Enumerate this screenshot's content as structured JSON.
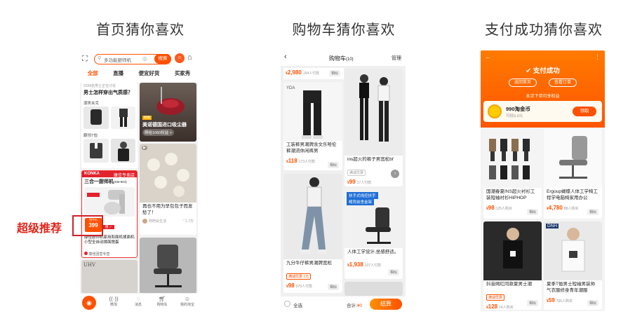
{
  "titles": [
    "首页猜你喜欢",
    "购物车猜你喜欢",
    "支付成功猜你喜欢"
  ],
  "callout": "超级推荐",
  "home": {
    "search_placeholder": "多功能厨师机",
    "search_btn": "搜索",
    "tabs": [
      "全部",
      "直播",
      "便宜好货",
      "买家秀"
    ],
    "c1_top": "9158名男士正在讨论",
    "c1_title": "男士怎样穿出气质感？",
    "c1_sec1": "潮男夹克",
    "c1_sec2": "翻领T恤",
    "c2_badge": "特惠",
    "c2_title": "美诺德国进口吸尘器",
    "c2_sub": "刚给1060权益 >",
    "konka": "KONKA",
    "konka_store": "康佳专卖店",
    "konka_title": "三合一厨师机",
    "konka_model": "(KM-904)",
    "konka_price": "399",
    "konka_free": "到手价",
    "konka_desc": "康佳厨师机家用和面机揉面机小型全自动揉面搅蛋",
    "konka_shop": "康佳团营专营",
    "bun_title": "再也不用为早包包子而发愁了！",
    "bun_user": "阿阿会生活",
    "bun_likes": "1.7万",
    "uhv": "UHV",
    "nav": [
      "微淘",
      "消息",
      "购物车",
      "我的淘宝"
    ]
  },
  "cart": {
    "title": "购物车",
    "count": "(10)",
    "manage": "管理",
    "top_price": "2,980",
    "top_sold": "194人付款",
    "p1_title": "工装裤男潮牌余文乐哈伦裤潮流休闲裤男",
    "p1_price": "118",
    "p1_sold": "173人付款",
    "p2_title": "ins超火的裤子男宽松bf",
    "p2_tag": "满减优惠",
    "p2_price": "99",
    "p2_sold": "17人付款",
    "p3_title": "九分牛仔裤男潮牌宽松",
    "p3_tag": "满减优惠 1元",
    "p3_price": "98",
    "p3_sold": "579人付款",
    "p4_banner": "扶手式线控扶手",
    "p4_banner2": "椅背前舍金架",
    "p4_title": "人体工学设计,坐感舒适。",
    "p4_price": "1,938",
    "p4_sold": "107人付款",
    "similar": "相似",
    "select_all": "全选",
    "total": "合计:",
    "total_val": "¥0",
    "checkout": "结算"
  },
  "pay": {
    "title": "支付成功",
    "back_home": "返回首页",
    "view_order": "查看订单",
    "rights": "本次下单可享权益",
    "coin": "990淘金币",
    "coin_sub": "可抵9.9元",
    "claim": "领取",
    "p1_title": "国潮春夏INS超火衬衫工装短袖衬衫HIPHOP",
    "p1_price": "98",
    "p1_sold": "125人购买",
    "p2_title": "Ergoup蝴蝶人体工学椅工程学电脑椅家用办公",
    "p2_price": "4,780",
    "p2_sold": "88人购买",
    "p3_title": "抖音网红同款夏男士潮",
    "p3_tag": "满减优惠",
    "p3_price": "128",
    "p3_sold": "14人购买",
    "dnh": "DNH",
    "p4_title": "夏季T恤男士短袖男装帅气衣服修身青年潮服",
    "p4_price": "59",
    "p4_sold": "766人购买",
    "similar": "相似"
  },
  "colors": {
    "accent": "#ff5000",
    "accent2": "#ff7a00",
    "red": "#d0202a"
  }
}
